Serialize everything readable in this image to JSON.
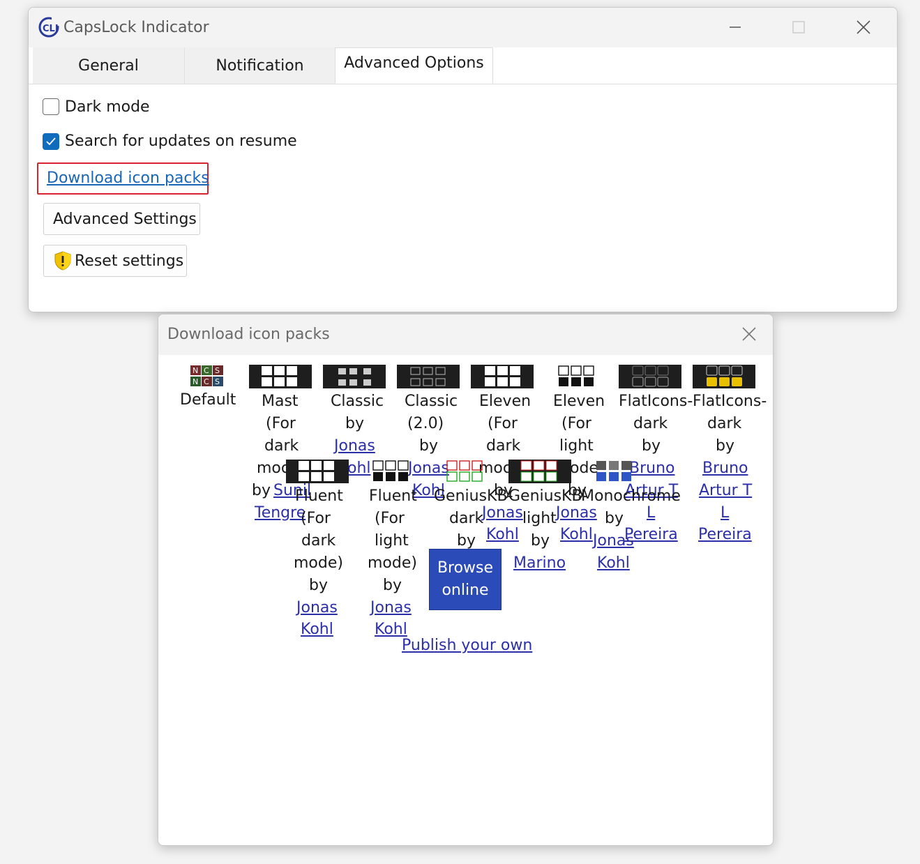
{
  "main_window": {
    "title": "CapsLock Indicator",
    "tabs": [
      "General",
      "Notification",
      "Advanced Options"
    ],
    "active_tab": "Advanced Options",
    "dark_mode_label": "Dark mode",
    "dark_mode_checked": false,
    "updates_label": "Search for updates on resume",
    "updates_checked": true,
    "download_link": "Download icon packs",
    "advanced_settings_button": "Advanced Settings",
    "reset_settings_button": "Reset settings"
  },
  "dialog": {
    "title": "Download icon packs",
    "packs": {
      "default": "Default",
      "mast": [
        "Mast",
        "(For",
        "dark",
        "moc",
        "by",
        "Sunil",
        "Tengre"
      ],
      "classic": [
        "Classic",
        "by",
        "Jonas",
        "ohl"
      ],
      "classic2": [
        "Classic",
        "(2.0)",
        "by",
        "Jonas",
        "Kohl"
      ],
      "eleven_dark": [
        "Eleven",
        "(For",
        "dark",
        "moc",
        "by",
        "Jonas",
        "Kohl"
      ],
      "eleven_light": [
        "Eleven",
        "(For",
        "light",
        "ode",
        "by",
        "Jonas",
        "Kohl"
      ],
      "flat_dark1": [
        "FlatIcons-",
        "dark",
        "by",
        "Bruno",
        "Artur T",
        "L",
        "Pereira"
      ],
      "flat_dark2": [
        "FlatIcons-",
        "dark",
        "by",
        "Bruno",
        "Artur T",
        "L",
        "Pereira"
      ],
      "fluent_dark": [
        "Fluent",
        "(For",
        "dark",
        "mode)",
        "by",
        "Jonas",
        "Kohl"
      ],
      "fluent_light": [
        "Fluent",
        "(For",
        "light",
        "mode)",
        "by",
        "Jonas",
        "Kohl"
      ],
      "genius_dark": [
        "GeniusKB-",
        "dark",
        "by"
      ],
      "genius_light": [
        "GeniusKB-",
        "light",
        "by",
        "Marino"
      ],
      "monochrome": [
        "Monochrome",
        "by",
        "Jonas",
        "Kohl"
      ]
    },
    "browse_online": [
      "Browse",
      "online"
    ],
    "publish_link": "Publish your own"
  },
  "colors": {
    "link_highlight": "#d6252f",
    "accent": "#0f6cbd",
    "browse_button": "#2b4bb8",
    "dialog_link": "#2c2fa8"
  }
}
